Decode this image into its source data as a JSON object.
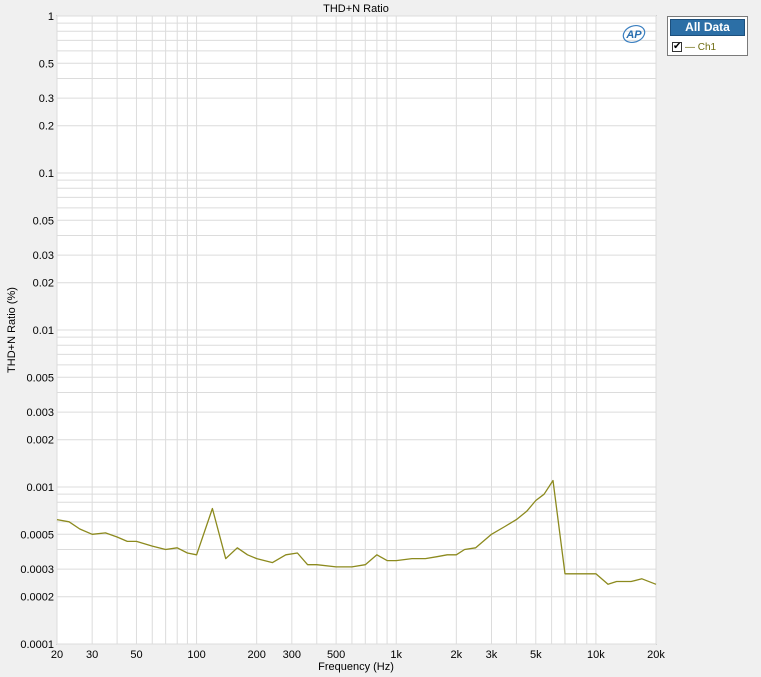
{
  "chart_data": {
    "type": "line",
    "title": "THD+N Ratio",
    "xlabel": "Frequency (Hz)",
    "ylabel": "THD+N Ratio (%)",
    "x_scale": "log",
    "y_scale": "log",
    "xlim": [
      20,
      20000
    ],
    "ylim": [
      0.0001,
      1
    ],
    "grid": true,
    "x_ticks": [
      {
        "value": 20,
        "label": "20"
      },
      {
        "value": 30,
        "label": "30"
      },
      {
        "value": 50,
        "label": "50"
      },
      {
        "value": 100,
        "label": "100"
      },
      {
        "value": 200,
        "label": "200"
      },
      {
        "value": 300,
        "label": "300"
      },
      {
        "value": 500,
        "label": "500"
      },
      {
        "value": 1000,
        "label": "1k"
      },
      {
        "value": 2000,
        "label": "2k"
      },
      {
        "value": 3000,
        "label": "3k"
      },
      {
        "value": 5000,
        "label": "5k"
      },
      {
        "value": 10000,
        "label": "10k"
      },
      {
        "value": 20000,
        "label": "20k"
      }
    ],
    "y_ticks": [
      {
        "value": 1,
        "label": "1"
      },
      {
        "value": 0.5,
        "label": "0.5"
      },
      {
        "value": 0.3,
        "label": "0.3"
      },
      {
        "value": 0.2,
        "label": "0.2"
      },
      {
        "value": 0.1,
        "label": "0.1"
      },
      {
        "value": 0.05,
        "label": "0.05"
      },
      {
        "value": 0.03,
        "label": "0.03"
      },
      {
        "value": 0.02,
        "label": "0.02"
      },
      {
        "value": 0.01,
        "label": "0.01"
      },
      {
        "value": 0.005,
        "label": "0.005"
      },
      {
        "value": 0.003,
        "label": "0.003"
      },
      {
        "value": 0.002,
        "label": "0.002"
      },
      {
        "value": 0.001,
        "label": "0.001"
      },
      {
        "value": 0.0005,
        "label": "0.0005"
      },
      {
        "value": 0.0003,
        "label": "0.0003"
      },
      {
        "value": 0.0002,
        "label": "0.0002"
      },
      {
        "value": 0.0001,
        "label": "0.0001"
      }
    ],
    "series": [
      {
        "name": "Ch1",
        "color": "#8c8a1e",
        "x": [
          20,
          23,
          26,
          30,
          35,
          40,
          45,
          50,
          60,
          70,
          80,
          90,
          100,
          120,
          140,
          160,
          180,
          200,
          240,
          280,
          320,
          360,
          400,
          500,
          600,
          700,
          800,
          900,
          1000,
          1200,
          1400,
          1600,
          1800,
          2000,
          2200,
          2500,
          3000,
          3500,
          4000,
          4500,
          5000,
          5500,
          6100,
          7000,
          8000,
          9000,
          10000,
          11500,
          12700,
          15000,
          17000,
          20000
        ],
        "y": [
          0.00062,
          0.0006,
          0.00054,
          0.0005,
          0.00051,
          0.00048,
          0.00045,
          0.00045,
          0.00042,
          0.0004,
          0.00041,
          0.00038,
          0.00037,
          0.00073,
          0.00035,
          0.00041,
          0.00037,
          0.00035,
          0.00033,
          0.00037,
          0.00038,
          0.00032,
          0.00032,
          0.00031,
          0.00031,
          0.00032,
          0.00037,
          0.00034,
          0.00034,
          0.00035,
          0.00035,
          0.00036,
          0.00037,
          0.00037,
          0.0004,
          0.00041,
          0.0005,
          0.00056,
          0.00062,
          0.0007,
          0.00082,
          0.0009,
          0.0011,
          0.00028,
          0.00028,
          0.00028,
          0.00028,
          0.00024,
          0.00025,
          0.00025,
          0.00026,
          0.00024
        ]
      }
    ]
  },
  "legend": {
    "header": "All Data",
    "items": [
      {
        "label": "— Ch1",
        "checked": true
      }
    ]
  },
  "logo_text": "AP"
}
